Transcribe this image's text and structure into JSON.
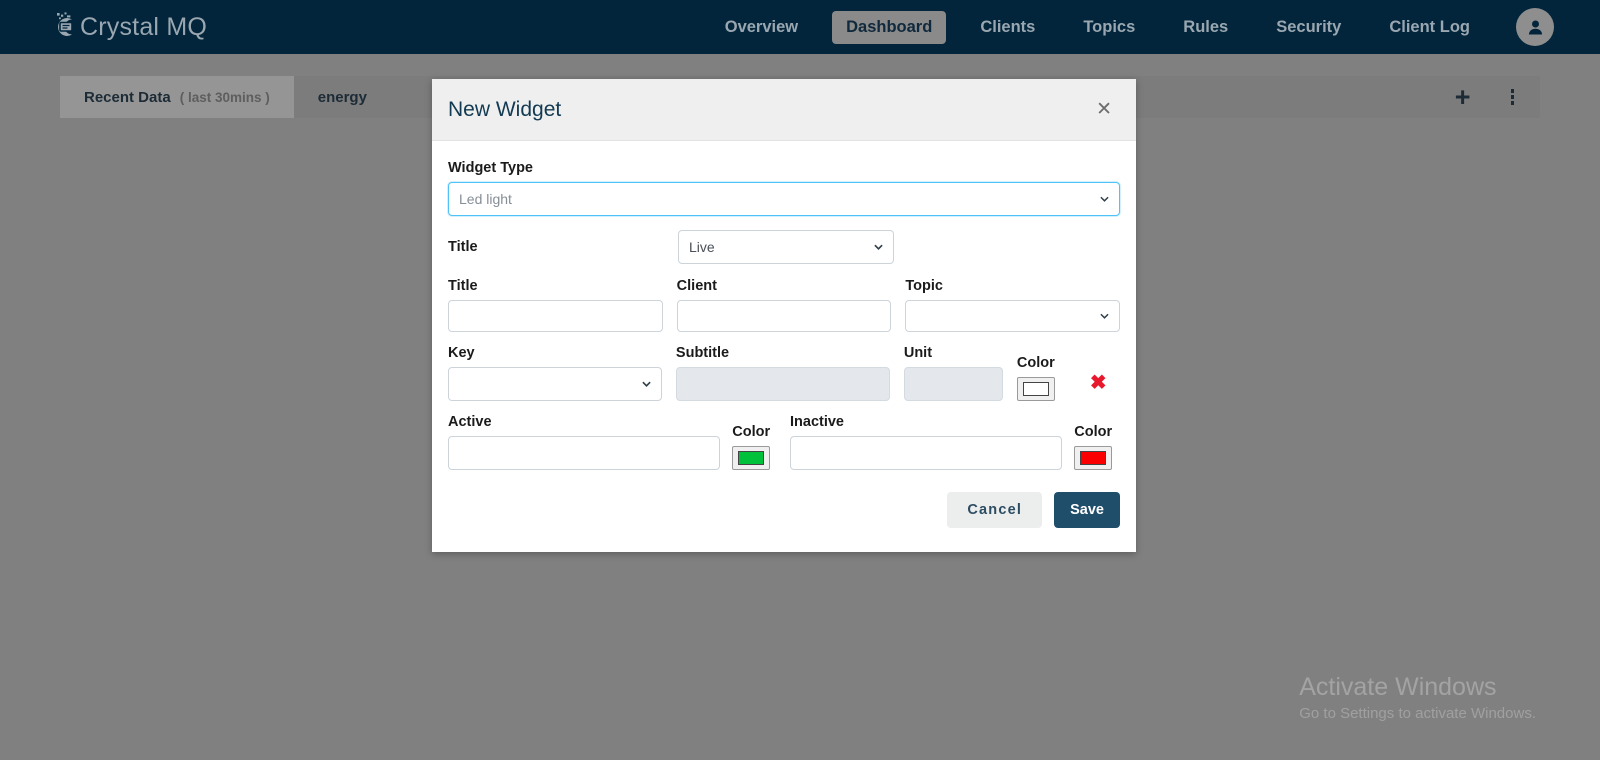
{
  "app": {
    "brand_name": "Crystal MQ",
    "brand_logo_icon": "crystal-mq-logo-icon",
    "nav_bg": "#02253c",
    "accent": "#1f4e6b"
  },
  "nav": {
    "items": [
      {
        "label": "Overview",
        "active": false
      },
      {
        "label": "Dashboard",
        "active": true
      },
      {
        "label": "Clients",
        "active": false
      },
      {
        "label": "Topics",
        "active": false
      },
      {
        "label": "Rules",
        "active": false
      },
      {
        "label": "Security",
        "active": false
      },
      {
        "label": "Client Log",
        "active": false
      }
    ],
    "avatar_icon": "user-icon"
  },
  "tabstrip": {
    "recent_title": "Recent Data",
    "recent_sub": "( last 30mins )",
    "energy_label": "energy",
    "add_icon": "plus-icon",
    "menu_icon": "kebab-menu-icon"
  },
  "modal": {
    "title": "New Widget",
    "close_icon": "close-icon",
    "widget_type": {
      "label": "Widget Type",
      "value": "Led light",
      "options": [
        "Led light"
      ]
    },
    "title_mode": {
      "label": "Title",
      "value": "Live",
      "options": [
        "Live"
      ]
    },
    "fields_row1": [
      {
        "label": "Title",
        "name": "title-input",
        "type": "text",
        "value": "",
        "placeholder": ""
      },
      {
        "label": "Client",
        "name": "client-input",
        "type": "text",
        "value": "",
        "placeholder": ""
      },
      {
        "label": "Topic",
        "name": "topic-select",
        "type": "select",
        "value": "",
        "options": []
      }
    ],
    "fields_row2": {
      "key": {
        "label": "Key",
        "value": "",
        "options": []
      },
      "subtitle": {
        "label": "Subtitle",
        "value": "",
        "placeholder": "",
        "disabled": true
      },
      "unit": {
        "label": "Unit",
        "value": "",
        "placeholder": "",
        "disabled": true
      },
      "color": {
        "label": "Color",
        "value": "#ffffff"
      },
      "delete_icon": "delete-row-icon"
    },
    "fields_row3": {
      "active": {
        "label": "Active",
        "value": "",
        "placeholder": ""
      },
      "active_color": {
        "label": "Color",
        "value": "#00c13a"
      },
      "inactive": {
        "label": "Inactive",
        "value": "",
        "placeholder": ""
      },
      "inactive_color": {
        "label": "Color",
        "value": "#fa0000"
      }
    },
    "buttons": {
      "cancel": "Cancel",
      "save": "Save"
    }
  },
  "watermark": {
    "line1": "Activate Windows",
    "line2": "Go to Settings to activate Windows."
  }
}
